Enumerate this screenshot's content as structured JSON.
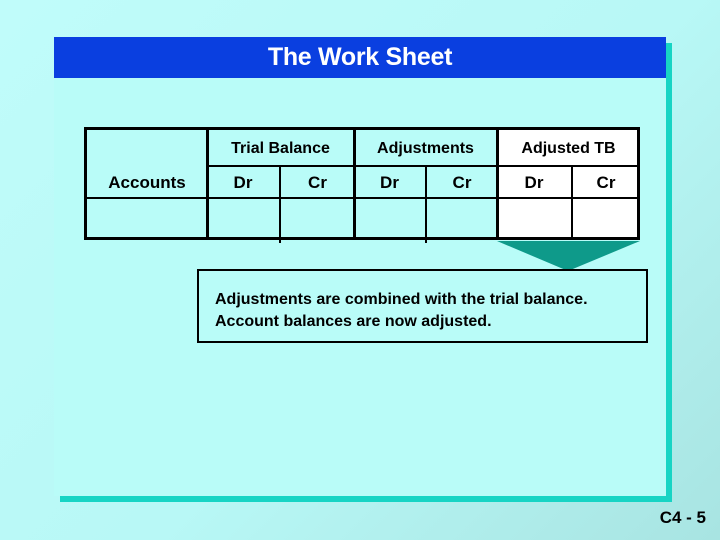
{
  "slide": {
    "title": "The Work Sheet",
    "slide_number": "C4 - 5"
  },
  "worksheet": {
    "accounts_header": "Accounts",
    "groups": [
      {
        "label": "Trial Balance",
        "columns": [
          "Dr",
          "Cr"
        ]
      },
      {
        "label": "Adjustments",
        "columns": [
          "Dr",
          "Cr"
        ]
      },
      {
        "label": "Adjusted TB",
        "columns": [
          "Dr",
          "Cr"
        ]
      }
    ],
    "highlighted_group": "Adjusted TB"
  },
  "callout": {
    "lines": [
      "Adjustments are combined with the trial balance.",
      "Account balances are now adjusted."
    ]
  },
  "colors": {
    "title_bar": "#0a3fe0",
    "panel": "#b9fcf8",
    "panel_shadow": "#17d4c4",
    "arrow": "#0e9a8a",
    "highlight_column": "#ffffff"
  }
}
